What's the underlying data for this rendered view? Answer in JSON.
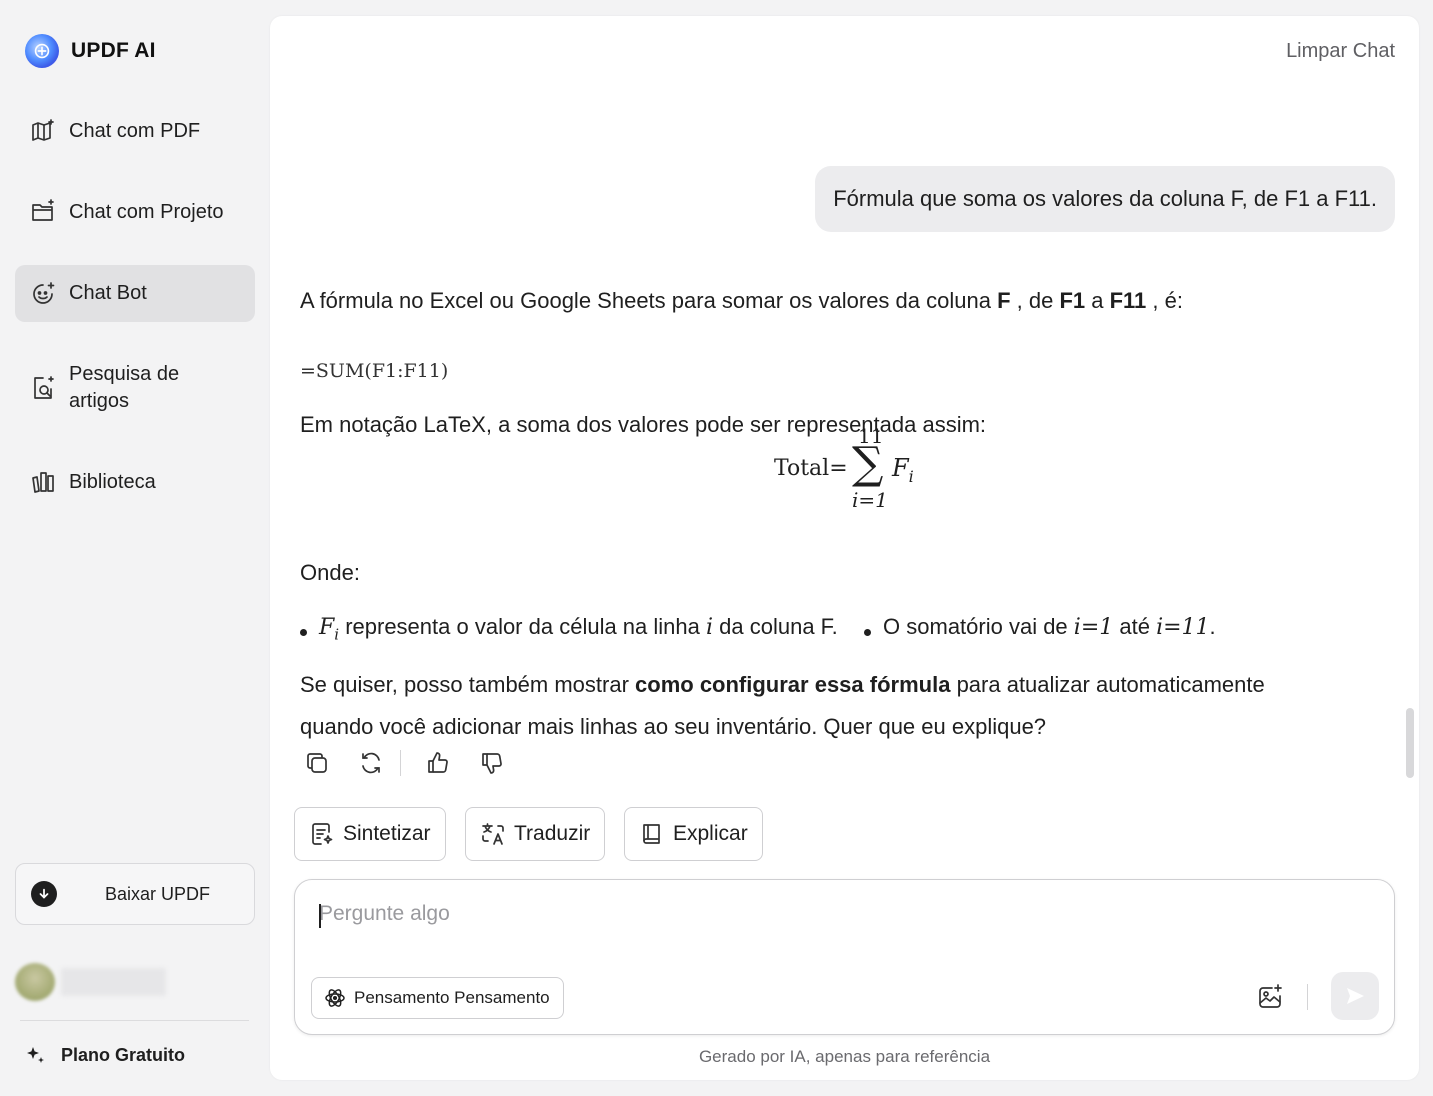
{
  "app": {
    "name": "UPDF AI"
  },
  "sidebar": {
    "items": [
      {
        "label": "Chat com PDF",
        "icon": "book-sparkle-icon",
        "active": false
      },
      {
        "label": "Chat com Projeto",
        "icon": "folder-sparkle-icon",
        "active": false
      },
      {
        "label": "Chat Bot",
        "icon": "bot-face-icon",
        "active": true
      },
      {
        "label": "Pesquisa de artigos",
        "icon": "document-search-icon",
        "active": false
      },
      {
        "label": "Biblioteca",
        "icon": "library-icon",
        "active": false
      }
    ],
    "download_label": "Baixar UPDF",
    "plan_label": "Plano Gratuito"
  },
  "header": {
    "clear_chat": "Limpar Chat"
  },
  "chat": {
    "user_message": "Fórmula que soma os valores da coluna F, de F1 a F11.",
    "answer": {
      "intro_a": "A fórmula no Excel ou Google Sheets para somar os valores da coluna ",
      "intro_b1": "F",
      "intro_c": " , de ",
      "intro_b2": "F1",
      "intro_d": " a ",
      "intro_b3": "F11",
      "intro_e": " , é:",
      "code": "=SUM(F1:F11)",
      "latex_intro": "Em notação LaTeX, a soma dos valores pode ser representada assim:",
      "formula": {
        "lhs": "Total",
        "eq": "=",
        "upper": "11",
        "lower": "i=1",
        "term": "Fi"
      },
      "onde": "Onde:",
      "bullet1_math": "F",
      "bullet1_sub": "i",
      "bullet1_text": " representa o valor da célula na linha ",
      "bullet1_var": "i",
      "bullet1_end": " da coluna F.",
      "bullet2_text": "O somatório vai de ",
      "bullet2_from": "i=1",
      "bullet2_mid": " até ",
      "bullet2_to": "i=11",
      "bullet2_end": ".",
      "closing_a": "Se quiser, posso também mostrar ",
      "closing_bold": "como configurar essa fórmula",
      "closing_b": " para atualizar automaticamente",
      "closing_line2": "quando você adicionar mais linhas ao seu inventário. Quer que eu explique?"
    }
  },
  "quick_actions": [
    "Sintetizar",
    "Traduzir",
    "Explicar"
  ],
  "input": {
    "placeholder": "Pergunte algo",
    "value": "",
    "think_label": "Pensamento Pensamento"
  },
  "footer": {
    "disclaimer": "Gerado por IA, apenas para referência"
  },
  "colors": {
    "background": "#f3f3f4",
    "panel": "#ffffff",
    "active_nav": "#e1e1e3",
    "bubble": "#ececee",
    "text": "#1f1f1f"
  }
}
